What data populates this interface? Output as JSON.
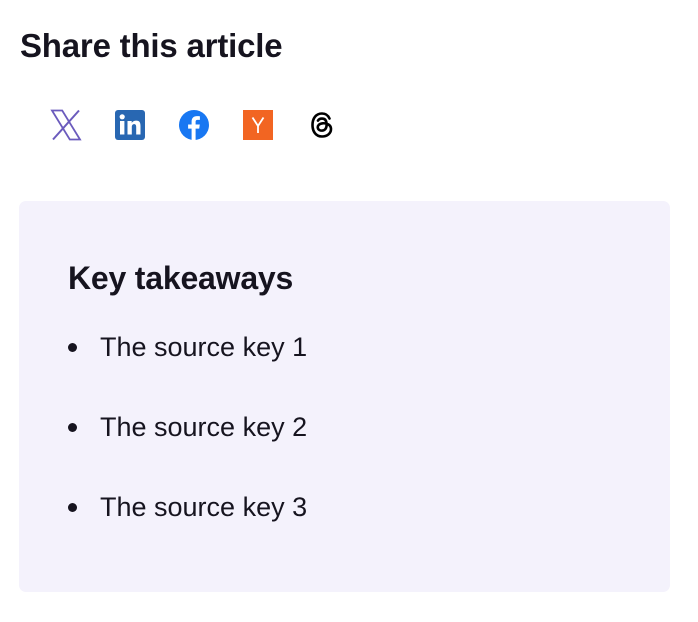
{
  "share": {
    "title": "Share this article",
    "links": [
      {
        "icon": "x-twitter-icon",
        "color": "#6b5bbd"
      },
      {
        "icon": "linkedin-icon",
        "color": "#2867b2"
      },
      {
        "icon": "facebook-icon",
        "color": "#1877f2"
      },
      {
        "icon": "hacker-news-icon",
        "color": "#f26522",
        "letter": "Y"
      },
      {
        "icon": "threads-icon",
        "color": "#000000"
      }
    ]
  },
  "takeaways": {
    "title": "Key takeaways",
    "background": "#f4f2fc",
    "items": [
      "The source key 1",
      "The source key 2",
      "The source key 3"
    ]
  }
}
